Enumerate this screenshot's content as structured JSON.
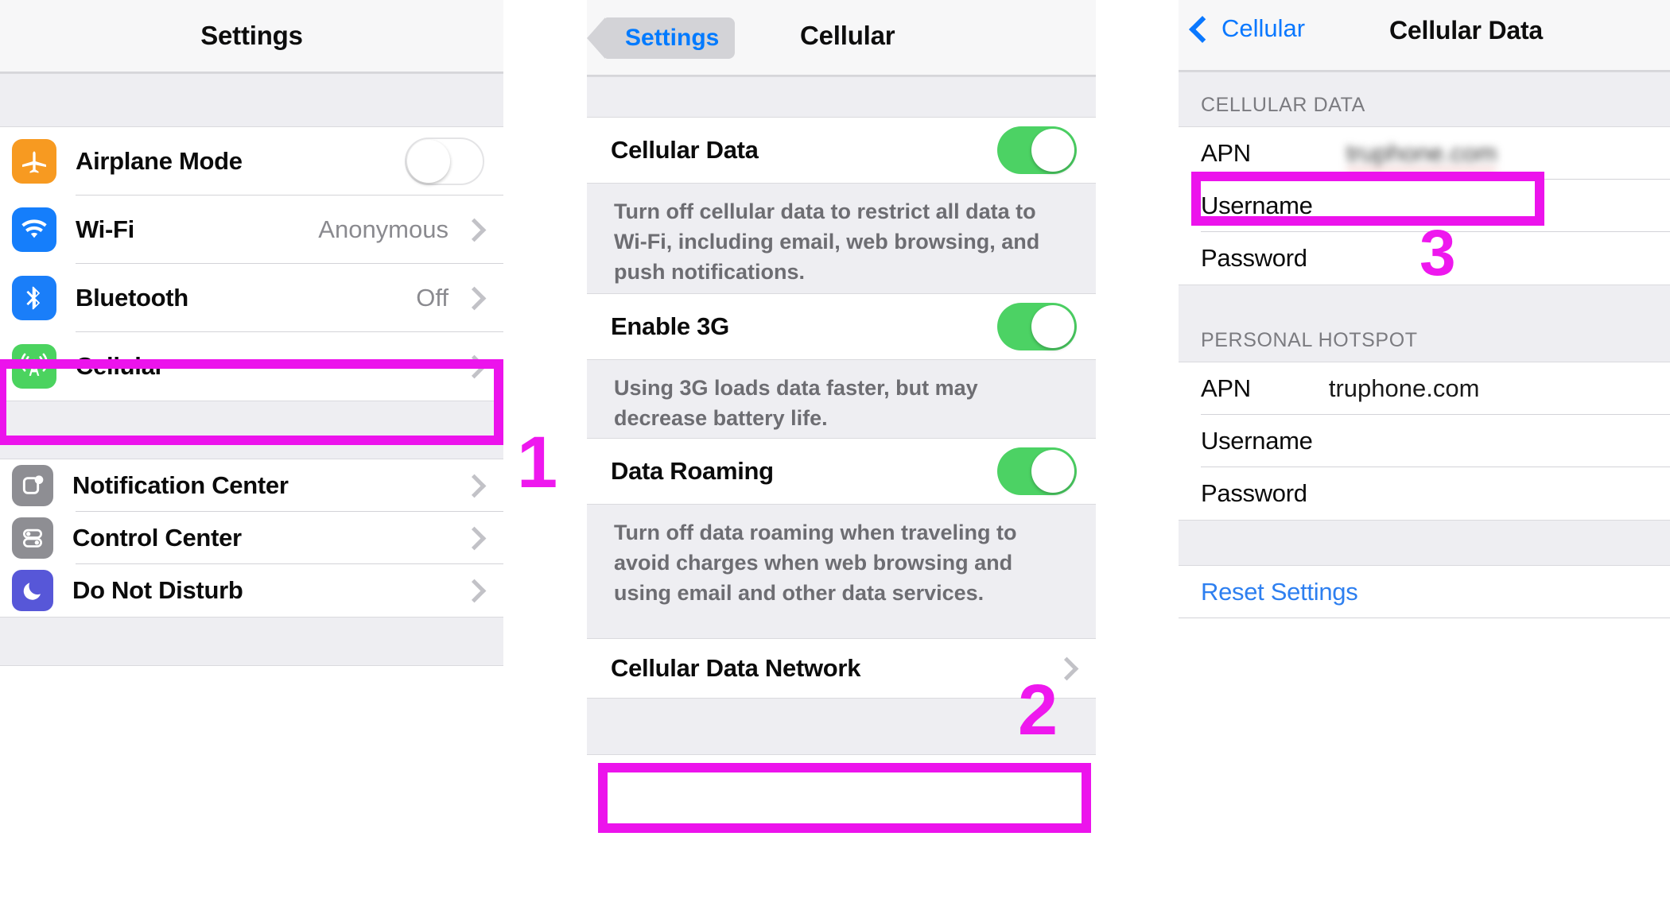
{
  "accent": {
    "highlight": "#ec13ec",
    "ios_blue": "#007aff",
    "toggle_on_green": "#4cd264"
  },
  "panel_settings": {
    "title": "Settings",
    "group1": [
      {
        "icon": "airplane-icon",
        "label": "Airplane Mode",
        "control": "toggle",
        "toggle_state": "off"
      },
      {
        "icon": "wifi-icon",
        "label": "Wi-Fi",
        "control": "value",
        "value": "Anonymous"
      },
      {
        "icon": "bluetooth-icon",
        "label": "Bluetooth",
        "control": "value",
        "value": "Off"
      },
      {
        "icon": "cellular-icon",
        "label": "Cellular",
        "control": "chevron",
        "value": ""
      }
    ],
    "group2": [
      {
        "icon": "notification-center-icon",
        "label": "Notification Center",
        "control": "chevron"
      },
      {
        "icon": "control-center-icon",
        "label": "Control Center",
        "control": "chevron"
      },
      {
        "icon": "do-not-disturb-icon",
        "label": "Do Not Disturb",
        "control": "chevron"
      }
    ],
    "step_marker": "1"
  },
  "panel_cellular": {
    "back_label": "Settings",
    "title": "Cellular",
    "rows": [
      {
        "label": "Cellular Data",
        "toggle_state": "on"
      },
      {
        "label": "Enable 3G",
        "toggle_state": "on"
      },
      {
        "label": "Data Roaming",
        "toggle_state": "on"
      }
    ],
    "help_cellular_data": "Turn off cellular data to restrict all data to Wi-Fi, including email, web browsing, and push notifications.",
    "help_enable_3g": "Using 3G loads data faster, but may decrease battery life.",
    "help_data_roaming": "Turn off data roaming when traveling to avoid charges when web browsing and using email and other data services.",
    "network_row_label": "Cellular Data Network",
    "step_marker": "2"
  },
  "panel_cellular_data": {
    "back_label": "Cellular",
    "title": "Cellular Data",
    "section_cellular_data": "CELLULAR DATA",
    "cellular_data_rows": [
      {
        "label": "APN",
        "value": "truphone.com",
        "redacted": true
      },
      {
        "label": "Username",
        "value": ""
      },
      {
        "label": "Password",
        "value": ""
      }
    ],
    "section_personal_hotspot": "PERSONAL HOTSPOT",
    "personal_hotspot_rows": [
      {
        "label": "APN",
        "value": "truphone.com"
      },
      {
        "label": "Username",
        "value": ""
      },
      {
        "label": "Password",
        "value": ""
      }
    ],
    "reset_label": "Reset Settings",
    "step_marker": "3"
  }
}
